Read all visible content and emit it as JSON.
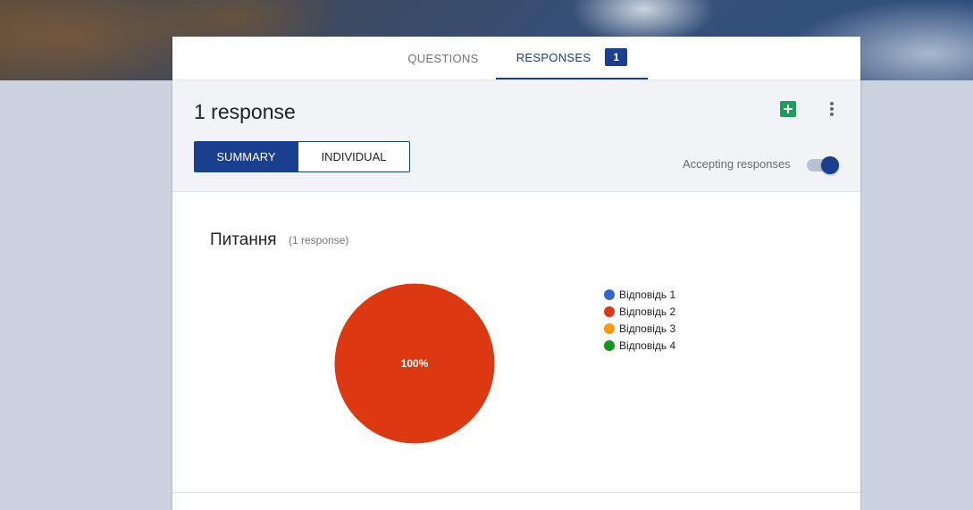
{
  "tabs": {
    "questions_label": "QUESTIONS",
    "responses_label": "RESPONSES",
    "responses_badge": "1"
  },
  "header": {
    "response_count": "1 response",
    "sheets_icon": "sheets-icon",
    "more_icon": "more-vert-icon",
    "summary_label": "SUMMARY",
    "individual_label": "INDIVIDUAL",
    "accepting_label": "Accepting responses",
    "accepting_on": true
  },
  "question": {
    "title": "Питання",
    "subtitle": "(1 response)"
  },
  "chart_data": {
    "type": "pie",
    "categories": [
      "Відповідь 1",
      "Відповідь 2",
      "Відповідь 3",
      "Відповідь 4"
    ],
    "values": [
      0,
      1,
      0,
      0
    ],
    "colors": [
      "#3366cc",
      "#dc3912",
      "#ff9900",
      "#109618"
    ],
    "slice_labels": [
      "",
      "100%",
      "",
      ""
    ],
    "legend_position": "right"
  }
}
